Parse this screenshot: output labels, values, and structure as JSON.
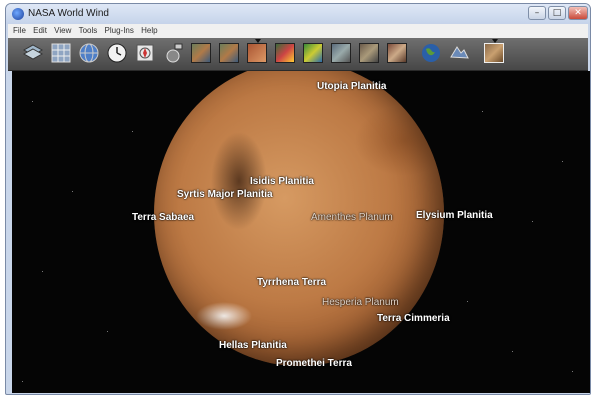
{
  "window": {
    "title": "NASA World Wind"
  },
  "menu": [
    "File",
    "Edit",
    "View",
    "Tools",
    "Plug-Ins",
    "Help"
  ],
  "toolbar": [
    {
      "icon": "layers-icon"
    },
    {
      "icon": "grid-icon"
    },
    {
      "icon": "globe-icon"
    },
    {
      "icon": "clock-icon"
    },
    {
      "icon": "compass-icon"
    },
    {
      "icon": "satellite-icon"
    },
    {
      "icon": "imagery-thumb-1"
    },
    {
      "icon": "imagery-thumb-2"
    },
    {
      "icon": "imagery-thumb-3"
    },
    {
      "icon": "imagery-thumb-4"
    },
    {
      "icon": "imagery-thumb-5"
    },
    {
      "icon": "imagery-thumb-6"
    },
    {
      "icon": "imagery-thumb-7"
    },
    {
      "icon": "imagery-thumb-8"
    },
    {
      "icon": "earth-icon"
    },
    {
      "icon": "map-icon"
    },
    {
      "icon": "mars-dataset-icon"
    }
  ],
  "map_labels": [
    {
      "text": "Utopia Planitia",
      "kind": "major"
    },
    {
      "text": "Isidis Planitia",
      "kind": "major"
    },
    {
      "text": "Syrtis Major Planitia",
      "kind": "major"
    },
    {
      "text": "Terra Sabaea",
      "kind": "major"
    },
    {
      "text": "Amenthes Planum",
      "kind": "minor"
    },
    {
      "text": "Elysium Planitia",
      "kind": "major"
    },
    {
      "text": "Tyrrhena Terra",
      "kind": "major"
    },
    {
      "text": "Hesperia Planum",
      "kind": "minor"
    },
    {
      "text": "Terra Cimmeria",
      "kind": "major"
    },
    {
      "text": "Hellas Planitia",
      "kind": "major"
    },
    {
      "text": "Promethei Terra",
      "kind": "major"
    }
  ]
}
